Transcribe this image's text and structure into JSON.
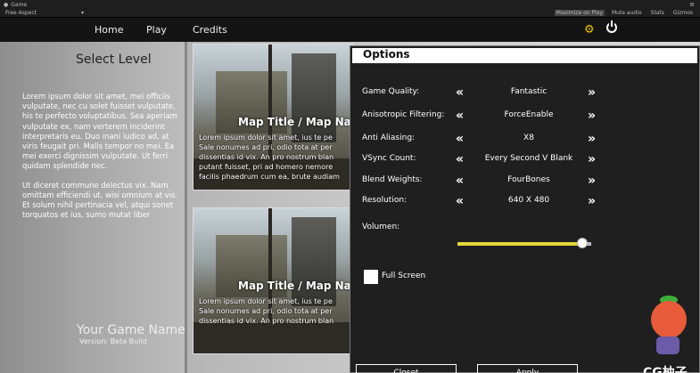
{
  "editor": {
    "tab_title": "Game",
    "aspect": "Free Aspect",
    "toggles": [
      "Maximize on Play",
      "Mute audio",
      "Stats",
      "Gizmos"
    ],
    "active_toggle_index": 0
  },
  "nav": {
    "items": [
      "Home",
      "Play",
      "Credits"
    ]
  },
  "left": {
    "title": "Select Level",
    "para1": "Lorem ipsum dolor sit amet, mei officiis vulputate, nec cu solet fuisset vulputate, his te perfecto voluptatibus. Sea aperiam vulputate ex, nam verterem inciderint interpretaris eu. Duo inani iudico ad, at viris feugait pri. Malis tempor no mei. Ea mei exerci dignissim vulputate. Ut ferri quidam splendide nec.",
    "para2": "Ut diceret commune delectus vix. Nam omittam efficiendi ut, wisi omnium at vis. Et solum nihil pertinacia vel, atqui sonet torquatos et ius, sumo mutat liber",
    "game_name": "Your Game Name",
    "version": "Version: Beta Build"
  },
  "maps": [
    {
      "title": "Map Title / Map Na",
      "desc": "Lorem ipsum dolor sit amet, ius te pe\nSale nonumes ad pri, odio tota at per\ndissentias id vix. An pro nostrum blan\nputant fuisset, pri ad homero nemore\nfacilis phaedrum cum ea, brute audiam"
    },
    {
      "title": "Map Title / Map Na",
      "desc": "Lorem ipsum dolor sit amet, ius te pe\nSale nonumes ad pri, odio tota at per\ndissentias id vix. An pro nostrum blan"
    }
  ],
  "options": {
    "title": "Options",
    "rows": [
      {
        "label": "Game Quality:",
        "value": "Fantastic"
      },
      {
        "label": "Anisotropic Filtering:",
        "value": "ForceEnable"
      },
      {
        "label": "Anti Aliasing:",
        "value": "X8"
      },
      {
        "label": "VSync Count:",
        "value": "Every Second V Blank"
      },
      {
        "label": "Blend Weights:",
        "value": "FourBones"
      },
      {
        "label": "Resolution:",
        "value": "640 X 480"
      }
    ],
    "volume_label": "Volumen:",
    "volume_level": 0.93,
    "fullscreen_label": "Full Screen",
    "fullscreen_checked": false,
    "close_label": "Closet",
    "apply_label": "Apply",
    "arrow_left": "«",
    "arrow_right": "»"
  },
  "watermark": "CG柚子"
}
